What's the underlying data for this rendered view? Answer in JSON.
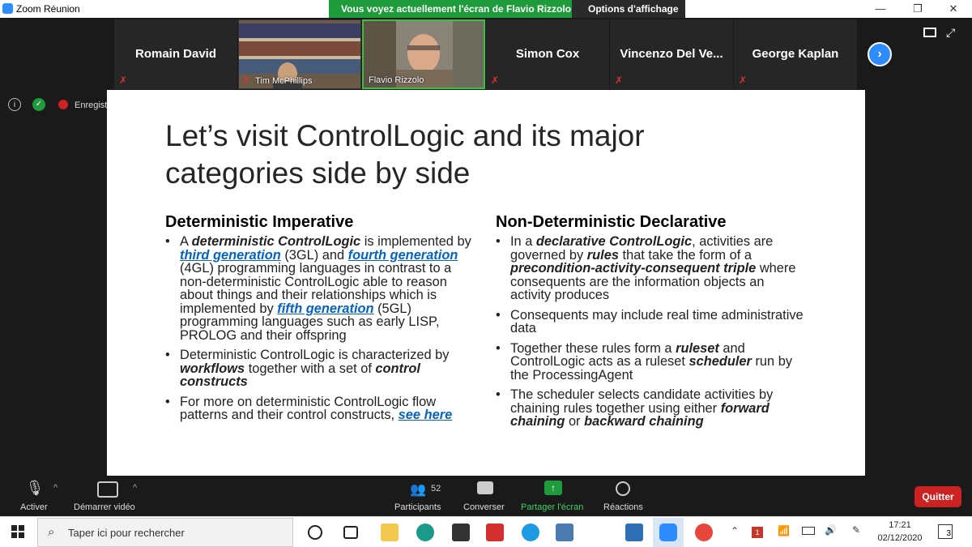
{
  "window": {
    "title": "Zoom Réunion"
  },
  "share_banner": {
    "message": "Vous voyez actuellement l'écran de Flavio Rizzolo",
    "options_label": "Options d'affichage"
  },
  "participants_strip": {
    "tiles": [
      {
        "name": "Romain David"
      },
      {
        "name": "Tim McPhillips"
      },
      {
        "name": "Flavio Rizzolo"
      },
      {
        "name": "Simon Cox"
      },
      {
        "name": "Vincenzo  Del  Ve..."
      },
      {
        "name": "George Kaplan"
      }
    ]
  },
  "status": {
    "recording_label": "Enregistr"
  },
  "slide": {
    "title_line1": "Let’s visit ControlLogic and its major",
    "title_line2": "categories side by side",
    "left": {
      "heading": "Deterministic Imperative",
      "b1": {
        "p1": "A ",
        "p2": "deterministic ControlLogic",
        "p3": " is implemented by ",
        "p4": "third generation",
        "p5": " (3GL) and ",
        "p6": "fourth generation",
        "p7": " (4GL) programming languages in contrast to a non-deterministic ControlLogic able to reason about things and their relationships which is implemented by ",
        "p8": "fifth generation",
        "p9": " (5GL) programming languages such as early LISP, PROLOG and their offspring"
      },
      "b2": {
        "p1": "Deterministic ControlLogic is characterized by ",
        "p2": "workflows",
        "p3": " together with a set of ",
        "p4": "control constructs"
      },
      "b3": {
        "p1": "For more on deterministic ControlLogic  flow patterns and their control constructs, ",
        "p2": "see here"
      }
    },
    "right": {
      "heading": "Non-Deterministic Declarative",
      "b1": {
        "p1": "In a ",
        "p2": "declarative ControlLogic",
        "p3": ", activities are governed by ",
        "p4": "rules",
        "p5": " that take the form of a ",
        "p6": "precondition-activity-consequent triple",
        "p7": " where consequents are the information objects an activity produces"
      },
      "b2": {
        "p1": "Consequents may include real time administrative data"
      },
      "b3": {
        "p1": "Together these rules form a ",
        "p2": "ruleset",
        "p3": " and ControlLogic acts as a ruleset ",
        "p4": "scheduler",
        "p5": " run by the ProcessingAgent"
      },
      "b4": {
        "p1": "The scheduler selects candidate activities by chaining rules together using either ",
        "p2": "forward chaining",
        "p3": " or ",
        "p4": "backward chaining"
      }
    }
  },
  "toolbar": {
    "mute": "Activer",
    "video": "Démarrer vidéo",
    "participants": "Participants",
    "participants_count": "52",
    "chat": "Converser",
    "share": "Partager l'écran",
    "reactions": "Réactions",
    "quit": "Quitter"
  },
  "taskbar": {
    "search_placeholder": "Taper ici pour rechercher",
    "time": "17:21",
    "date": "02/12/2020",
    "notifications": "3",
    "badge": "1"
  },
  "colors": {
    "share_green": "#1e9b3a",
    "zoom_blue": "#2d8cff",
    "quit_red": "#cc2222",
    "link_blue": "#0563c1"
  }
}
